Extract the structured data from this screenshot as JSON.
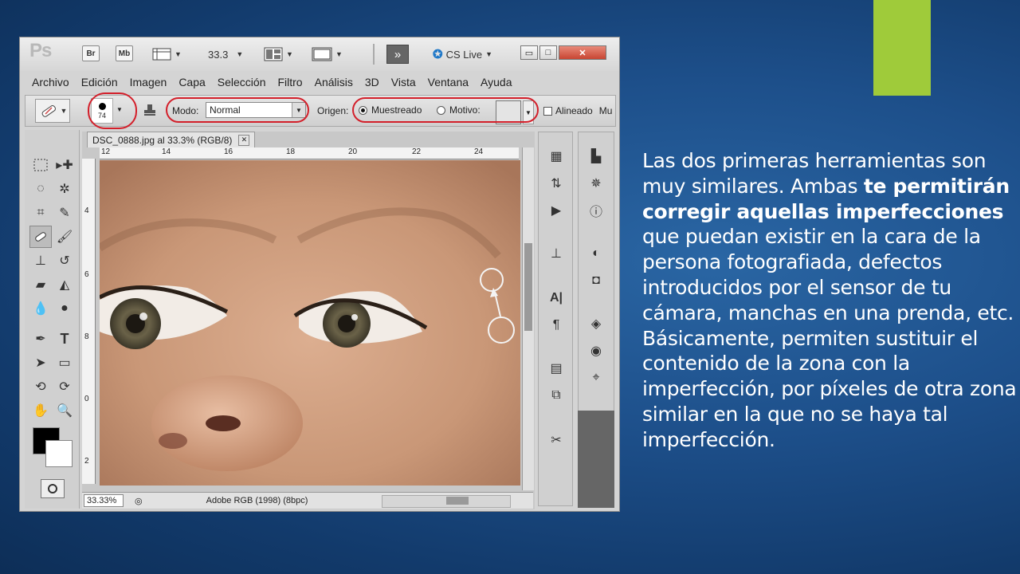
{
  "slide": {
    "text_parts": [
      "Las dos primeras herramientas son muy similares. Ambas ",
      "te permitirán corregir aquellas imperfecciones",
      " que puedan existir en la cara de la persona fotografiada, defectos introducidos por el sensor de tu cámara, manchas en una prenda, etc. Básicamente, permiten sustituir el contenido de la zona con la imperfección, por píxeles de otra zona similar en la que no se haya tal imperfección."
    ],
    "accent_color": "#9fcb3a",
    "background_color": "#1d4f8a"
  },
  "app": {
    "logo": "Ps",
    "bridge_button": "Br",
    "minibridge_button": "Mb",
    "zoom": "33.3",
    "forward_icon": "»",
    "cs_live": "CS Live",
    "window_controls": [
      "▭",
      "□",
      "✕"
    ]
  },
  "menu": [
    "Archivo",
    "Edición",
    "Imagen",
    "Capa",
    "Selección",
    "Filtro",
    "Análisis",
    "3D",
    "Vista",
    "Ventana",
    "Ayuda"
  ],
  "options": {
    "brush_size": "74",
    "mode_label": "Modo:",
    "mode_value": "Normal",
    "origin_label": "Origen:",
    "sampled_label": "Muestreado",
    "pattern_label": "Motivo:",
    "aligned_label": "Alineado",
    "sample_label": "Mu"
  },
  "document": {
    "tab_title": "DSC_0888.jpg al 33.3% (RGB/8)",
    "ruler_top": [
      "12",
      "14",
      "16",
      "18",
      "20",
      "22",
      "24"
    ],
    "ruler_left": [
      "4",
      "6",
      "8",
      "0",
      "2"
    ],
    "zoom_status": "33.33%",
    "profile": "Adobe RGB (1998) (8bpc)"
  },
  "icons": {
    "tools": [
      "marquee-icon",
      "move-icon",
      "lasso-icon",
      "magic-wand-icon",
      "crop-icon",
      "eyedropper-icon",
      "healing-brush-icon",
      "brush-icon",
      "clone-stamp-icon",
      "history-brush-icon",
      "eraser-icon",
      "paint-bucket-icon",
      "blur-icon",
      "dodge-icon",
      "pen-icon",
      "type-icon",
      "path-select-icon",
      "shape-icon",
      "3d-rotate-icon",
      "3d-orbit-icon",
      "hand-icon",
      "zoom-icon"
    ],
    "panels": [
      "minibridge-panel-icon",
      "history-panel-icon",
      "actions-panel-icon",
      "clone-source-panel-icon",
      "character-panel-icon",
      "paragraph-panel-icon",
      "notes-panel-icon",
      "layer-comps-panel-icon",
      "tool-presets-panel-icon",
      "histogram-panel-icon",
      "navigator-panel-icon",
      "info-panel-icon",
      "adjustments-panel-icon",
      "masks-panel-icon",
      "layers-panel-icon",
      "channels-panel-icon",
      "paths-panel-icon"
    ]
  }
}
